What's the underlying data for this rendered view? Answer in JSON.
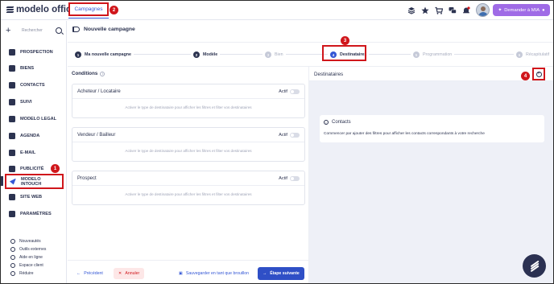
{
  "app": {
    "logo_text": "modelo office"
  },
  "topbar": {
    "active_tab": "Campagnes",
    "mia_label": "Demander à MIA",
    "icons": [
      "stack-icon",
      "star-icon",
      "cart-icon",
      "chat-icon",
      "bell-icon"
    ]
  },
  "annotations": {
    "b1": "1",
    "b2": "2",
    "b3": "3",
    "b4": "4",
    "accent_color": "#d0161b"
  },
  "sidebar": {
    "search_placeholder": "Rechercher",
    "items": [
      {
        "label": "PROSPECTION"
      },
      {
        "label": "BIENS"
      },
      {
        "label": "CONTACTS"
      },
      {
        "label": "SUIVI"
      },
      {
        "label": "MODELO LEGAL"
      },
      {
        "label": "AGENDA"
      },
      {
        "label": "E-MAIL"
      },
      {
        "label": "PUBLICITÉ"
      },
      {
        "label": "MODELO INTOUCH"
      },
      {
        "label": "SITE WEB"
      },
      {
        "label": "PARAMÈTRES"
      }
    ],
    "utilities": [
      {
        "label": "Nouveautés"
      },
      {
        "label": "Outils externes"
      },
      {
        "label": "Aide en ligne"
      },
      {
        "label": "Espace client"
      },
      {
        "label": "Réduire"
      }
    ]
  },
  "main": {
    "header_title": "Nouvelle campagne",
    "steps": [
      {
        "num": "1",
        "label": "Ma nouvelle campagne",
        "state": "done"
      },
      {
        "num": "2",
        "label": "Modèle",
        "state": "done"
      },
      {
        "num": "3",
        "label": "Bien",
        "state": "pending"
      },
      {
        "num": "4",
        "label": "Destinataires",
        "state": "current"
      },
      {
        "num": "5",
        "label": "Programmation",
        "state": "pending"
      },
      {
        "num": "6",
        "label": "Récapitulatif",
        "state": "pending"
      }
    ],
    "conditions_title": "Conditions",
    "conditions": [
      {
        "title": "Acheteur / Locataire",
        "actif": "Actif",
        "hint": "Activer le type de destinataire pour afficher les filtres et filter vos destinataires"
      },
      {
        "title": "Vendeur / Bailleur",
        "actif": "Actif",
        "hint": "Activer le type de destinataire pour afficher les filtres et filter vos destinataires"
      },
      {
        "title": "Prospect",
        "actif": "Actif",
        "hint": "Activer le type de destinataire pour afficher les filtres et filter vos destinataires"
      }
    ],
    "footer": {
      "prev": "Précédent",
      "cancel": "Annuler",
      "save_draft": "Sauvegarder en tant que brouillon",
      "next": "Étape suivante"
    },
    "recipients": {
      "title": "Destinataires",
      "contacts_title": "Contacts",
      "contacts_desc": "Commencer par ajouter des filtres pour afficher les contacts correspondants à votre recherche"
    }
  }
}
